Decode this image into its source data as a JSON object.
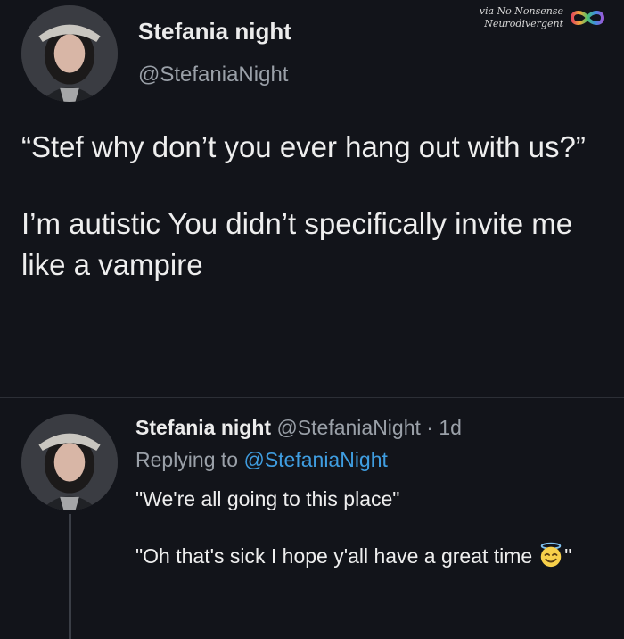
{
  "watermark": {
    "line1": "via No Nonsense",
    "line2": "Neurodivergent",
    "icon": "infinity-icon"
  },
  "main_tweet": {
    "name": "Stefania night",
    "handle": "@StefaniaNight",
    "paragraph1": "“Stef why don’t you ever hang out with us?”",
    "paragraph2": "I’m autistic You didn’t specifically invite me like a vampire"
  },
  "reply_tweet": {
    "name": "Stefania night",
    "handle": "@StefaniaNight",
    "separator": "·",
    "time": "1d",
    "replying_prefix": "Replying to",
    "replying_to": "@StefaniaNight",
    "line1": "\"We're all going to this place\"",
    "line2_text": "\"Oh that's sick I hope y'all have a great time",
    "line2_emoji": "smiling-face-with-halo-icon",
    "line2_end": "\""
  },
  "colors": {
    "background": "#12141a",
    "text": "#eeeeee",
    "muted": "#9aa0a8",
    "link": "#3f9de0"
  }
}
